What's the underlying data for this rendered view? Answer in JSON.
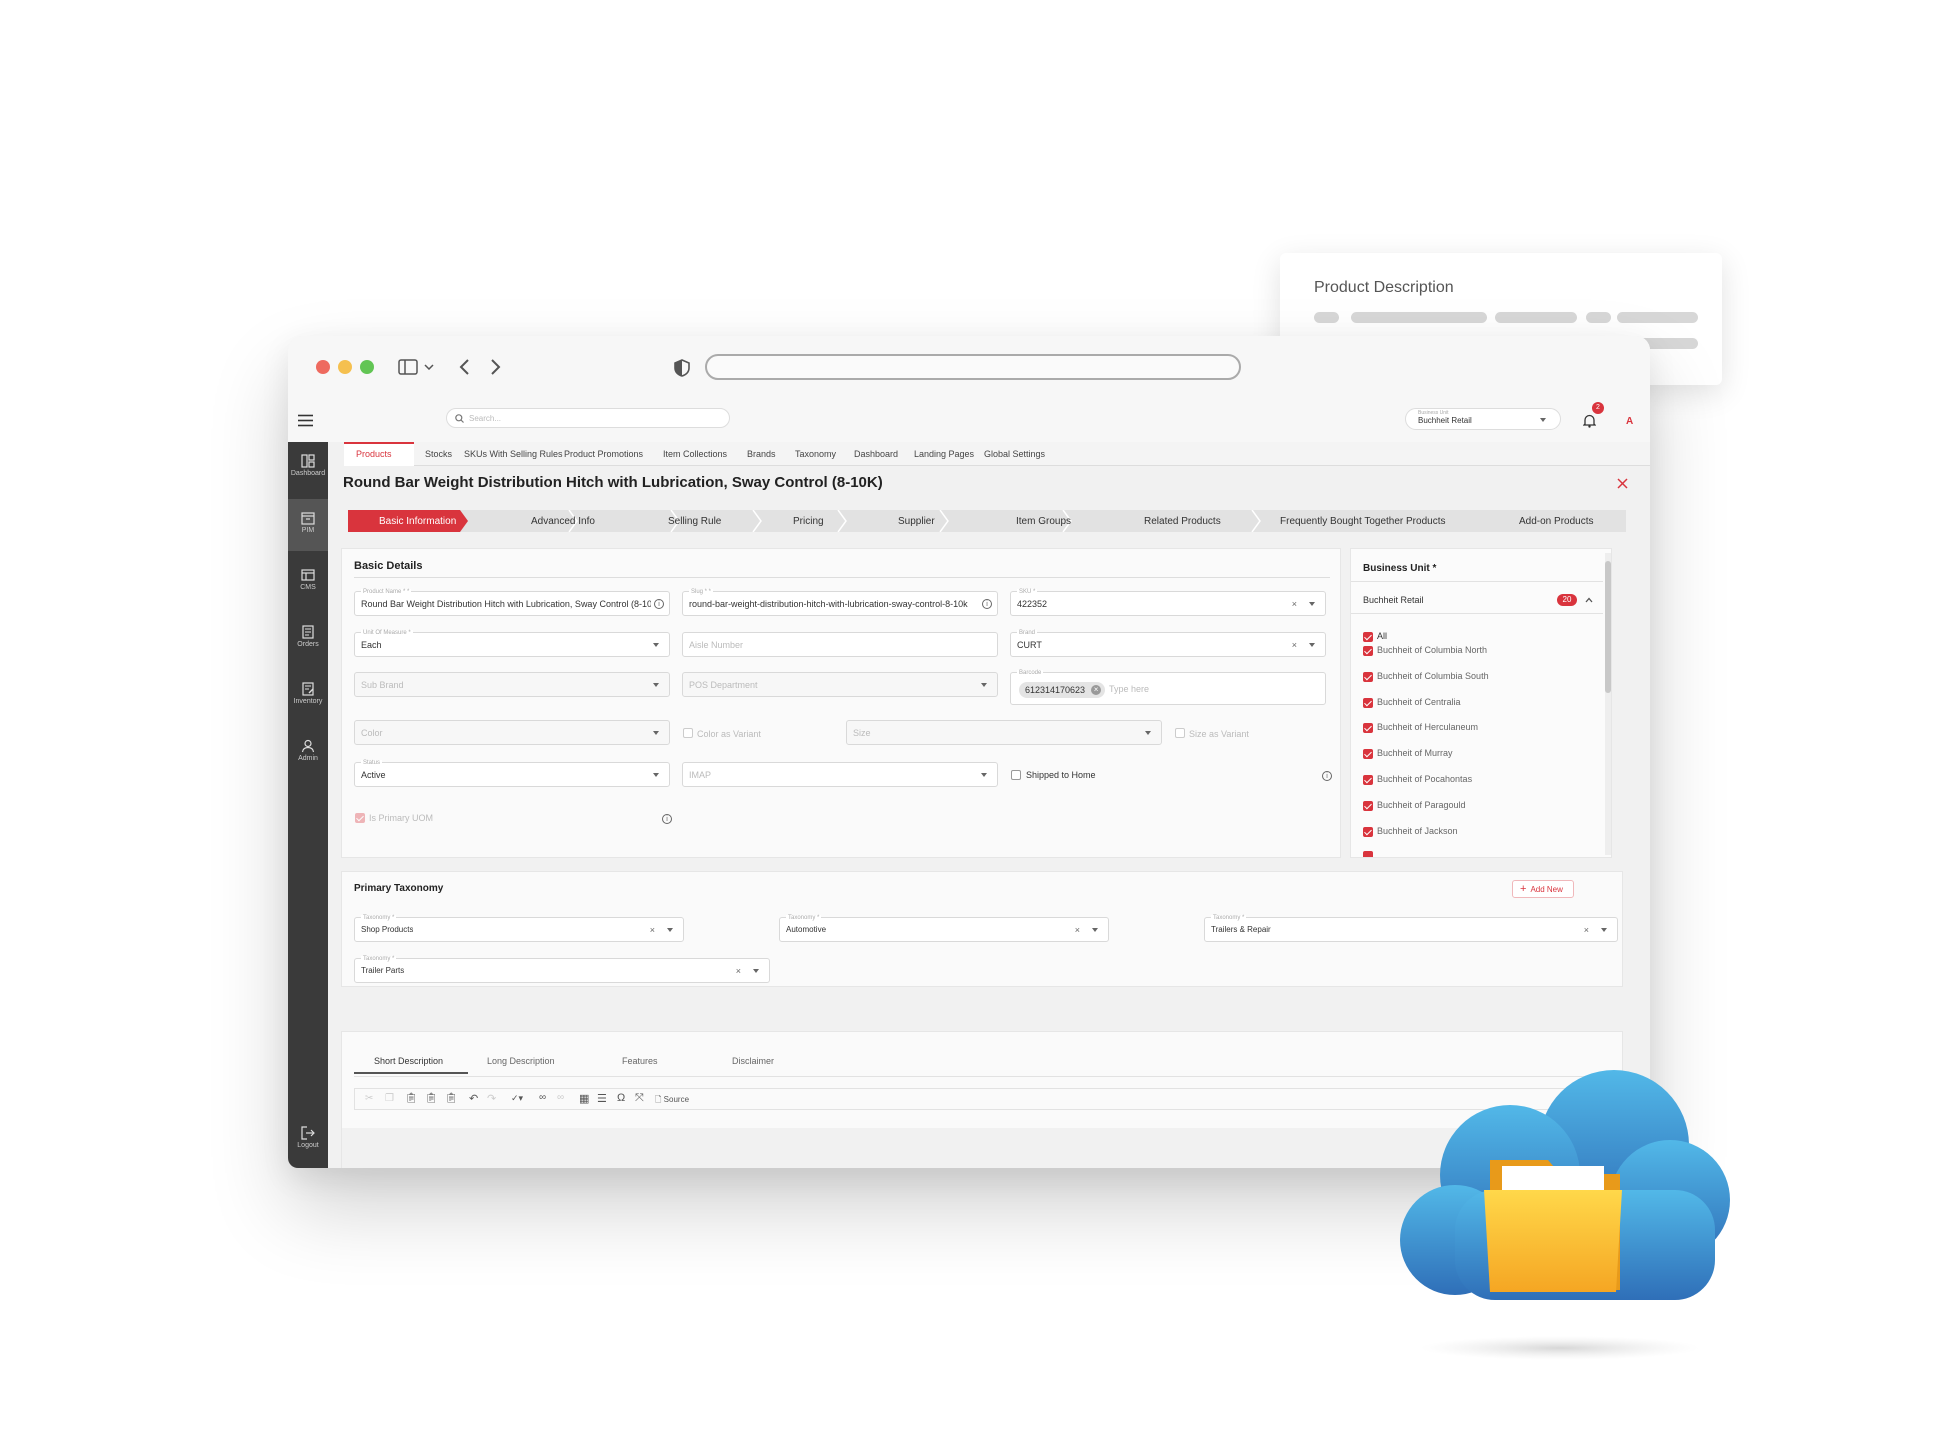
{
  "floating_card": {
    "title": "Product Description"
  },
  "sidebar": [
    {
      "label": "Dashboard",
      "icon": "dashboard-icon"
    },
    {
      "label": "PIM",
      "icon": "pim-icon"
    },
    {
      "label": "CMS",
      "icon": "cms-icon"
    },
    {
      "label": "Orders",
      "icon": "orders-icon"
    },
    {
      "label": "Inventory",
      "icon": "inventory-icon"
    },
    {
      "label": "Admin",
      "icon": "admin-icon"
    },
    {
      "label": "Logout",
      "icon": "logout-icon"
    }
  ],
  "topbar": {
    "search_placeholder": "Search...",
    "business_unit_label": "Business Unit",
    "business_unit_value": "Buchheit Retail",
    "notifications": "2",
    "avatar": "A"
  },
  "tabs": [
    "Products",
    "Stocks",
    "SKUs With Selling Rules",
    "Product Promotions",
    "Item Collections",
    "Brands",
    "Taxonomy",
    "Dashboard",
    "Landing Pages",
    "Global Settings"
  ],
  "page_title": "Round Bar Weight Distribution Hitch with Lubrication, Sway Control (8-10K)",
  "steps": [
    "Basic Information",
    "Advanced Info",
    "Selling Rule",
    "Pricing",
    "Supplier",
    "Item Groups",
    "Related Products",
    "Frequently Bought Together Products",
    "Add-on Products"
  ],
  "basic": {
    "title": "Basic Details",
    "product_name_label": "Product Name * *",
    "product_name": "Round Bar Weight Distribution Hitch with Lubrication, Sway Control (8-10K)",
    "slug_label": "Slug * *",
    "slug": "round-bar-weight-distribution-hitch-with-lubrication-sway-control-8-10k",
    "sku_label": "SKU *",
    "sku": "422352",
    "uom_label": "Unit Of Measure *",
    "uom": "Each",
    "aisle": "Aisle Number",
    "brand_label": "Brand",
    "brand": "CURT",
    "sub_brand": "Sub Brand",
    "pos_department": "POS Department",
    "barcode_label": "Barcode",
    "barcode": "612314170623",
    "barcode_placeholder": "Type here",
    "color": "Color",
    "color_as_variant": "Color as Variant",
    "size": "Size",
    "size_as_variant": "Size as Variant",
    "status_label": "Status",
    "status": "Active",
    "imap": "IMAP",
    "shipped_to_home": "Shipped to Home",
    "is_primary_uom": "Is Primary UOM"
  },
  "business_unit": {
    "title": "Business Unit *",
    "group": "Buchheit Retail",
    "count": "20",
    "items": [
      "All",
      "Buchheit of Columbia North",
      "Buchheit of Columbia South",
      "Buchheit of Centralia",
      "Buchheit of Herculaneum",
      "Buchheit of Murray",
      "Buchheit of Pocahontas",
      "Buchheit of Paragould",
      "Buchheit of Jackson"
    ]
  },
  "taxonomy": {
    "title": "Primary Taxonomy",
    "add_new": "Add New",
    "field_label": "Taxonomy *",
    "values": [
      "Shop Products",
      "Automotive",
      "Trailers & Repair",
      "Trailer Parts"
    ]
  },
  "description_tabs": [
    "Short Description",
    "Long Description",
    "Features",
    "Disclaimer"
  ],
  "editor": {
    "source_label": "Source"
  }
}
